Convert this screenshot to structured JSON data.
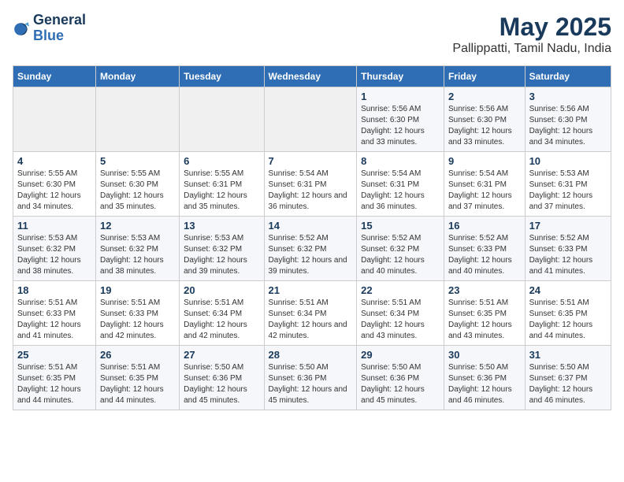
{
  "header": {
    "logo_line1": "General",
    "logo_line2": "Blue",
    "title": "May 2025",
    "subtitle": "Pallippatti, Tamil Nadu, India"
  },
  "weekdays": [
    "Sunday",
    "Monday",
    "Tuesday",
    "Wednesday",
    "Thursday",
    "Friday",
    "Saturday"
  ],
  "weeks": [
    [
      {
        "day": "",
        "empty": true
      },
      {
        "day": "",
        "empty": true
      },
      {
        "day": "",
        "empty": true
      },
      {
        "day": "",
        "empty": true
      },
      {
        "day": "1",
        "sunrise": "5:56 AM",
        "sunset": "6:30 PM",
        "daylight": "12 hours and 33 minutes."
      },
      {
        "day": "2",
        "sunrise": "5:56 AM",
        "sunset": "6:30 PM",
        "daylight": "12 hours and 33 minutes."
      },
      {
        "day": "3",
        "sunrise": "5:56 AM",
        "sunset": "6:30 PM",
        "daylight": "12 hours and 34 minutes."
      }
    ],
    [
      {
        "day": "4",
        "sunrise": "5:55 AM",
        "sunset": "6:30 PM",
        "daylight": "12 hours and 34 minutes."
      },
      {
        "day": "5",
        "sunrise": "5:55 AM",
        "sunset": "6:30 PM",
        "daylight": "12 hours and 35 minutes."
      },
      {
        "day": "6",
        "sunrise": "5:55 AM",
        "sunset": "6:31 PM",
        "daylight": "12 hours and 35 minutes."
      },
      {
        "day": "7",
        "sunrise": "5:54 AM",
        "sunset": "6:31 PM",
        "daylight": "12 hours and 36 minutes."
      },
      {
        "day": "8",
        "sunrise": "5:54 AM",
        "sunset": "6:31 PM",
        "daylight": "12 hours and 36 minutes."
      },
      {
        "day": "9",
        "sunrise": "5:54 AM",
        "sunset": "6:31 PM",
        "daylight": "12 hours and 37 minutes."
      },
      {
        "day": "10",
        "sunrise": "5:53 AM",
        "sunset": "6:31 PM",
        "daylight": "12 hours and 37 minutes."
      }
    ],
    [
      {
        "day": "11",
        "sunrise": "5:53 AM",
        "sunset": "6:32 PM",
        "daylight": "12 hours and 38 minutes."
      },
      {
        "day": "12",
        "sunrise": "5:53 AM",
        "sunset": "6:32 PM",
        "daylight": "12 hours and 38 minutes."
      },
      {
        "day": "13",
        "sunrise": "5:53 AM",
        "sunset": "6:32 PM",
        "daylight": "12 hours and 39 minutes."
      },
      {
        "day": "14",
        "sunrise": "5:52 AM",
        "sunset": "6:32 PM",
        "daylight": "12 hours and 39 minutes."
      },
      {
        "day": "15",
        "sunrise": "5:52 AM",
        "sunset": "6:32 PM",
        "daylight": "12 hours and 40 minutes."
      },
      {
        "day": "16",
        "sunrise": "5:52 AM",
        "sunset": "6:33 PM",
        "daylight": "12 hours and 40 minutes."
      },
      {
        "day": "17",
        "sunrise": "5:52 AM",
        "sunset": "6:33 PM",
        "daylight": "12 hours and 41 minutes."
      }
    ],
    [
      {
        "day": "18",
        "sunrise": "5:51 AM",
        "sunset": "6:33 PM",
        "daylight": "12 hours and 41 minutes."
      },
      {
        "day": "19",
        "sunrise": "5:51 AM",
        "sunset": "6:33 PM",
        "daylight": "12 hours and 42 minutes."
      },
      {
        "day": "20",
        "sunrise": "5:51 AM",
        "sunset": "6:34 PM",
        "daylight": "12 hours and 42 minutes."
      },
      {
        "day": "21",
        "sunrise": "5:51 AM",
        "sunset": "6:34 PM",
        "daylight": "12 hours and 42 minutes."
      },
      {
        "day": "22",
        "sunrise": "5:51 AM",
        "sunset": "6:34 PM",
        "daylight": "12 hours and 43 minutes."
      },
      {
        "day": "23",
        "sunrise": "5:51 AM",
        "sunset": "6:35 PM",
        "daylight": "12 hours and 43 minutes."
      },
      {
        "day": "24",
        "sunrise": "5:51 AM",
        "sunset": "6:35 PM",
        "daylight": "12 hours and 44 minutes."
      }
    ],
    [
      {
        "day": "25",
        "sunrise": "5:51 AM",
        "sunset": "6:35 PM",
        "daylight": "12 hours and 44 minutes."
      },
      {
        "day": "26",
        "sunrise": "5:51 AM",
        "sunset": "6:35 PM",
        "daylight": "12 hours and 44 minutes."
      },
      {
        "day": "27",
        "sunrise": "5:50 AM",
        "sunset": "6:36 PM",
        "daylight": "12 hours and 45 minutes."
      },
      {
        "day": "28",
        "sunrise": "5:50 AM",
        "sunset": "6:36 PM",
        "daylight": "12 hours and 45 minutes."
      },
      {
        "day": "29",
        "sunrise": "5:50 AM",
        "sunset": "6:36 PM",
        "daylight": "12 hours and 45 minutes."
      },
      {
        "day": "30",
        "sunrise": "5:50 AM",
        "sunset": "6:36 PM",
        "daylight": "12 hours and 46 minutes."
      },
      {
        "day": "31",
        "sunrise": "5:50 AM",
        "sunset": "6:37 PM",
        "daylight": "12 hours and 46 minutes."
      }
    ]
  ]
}
